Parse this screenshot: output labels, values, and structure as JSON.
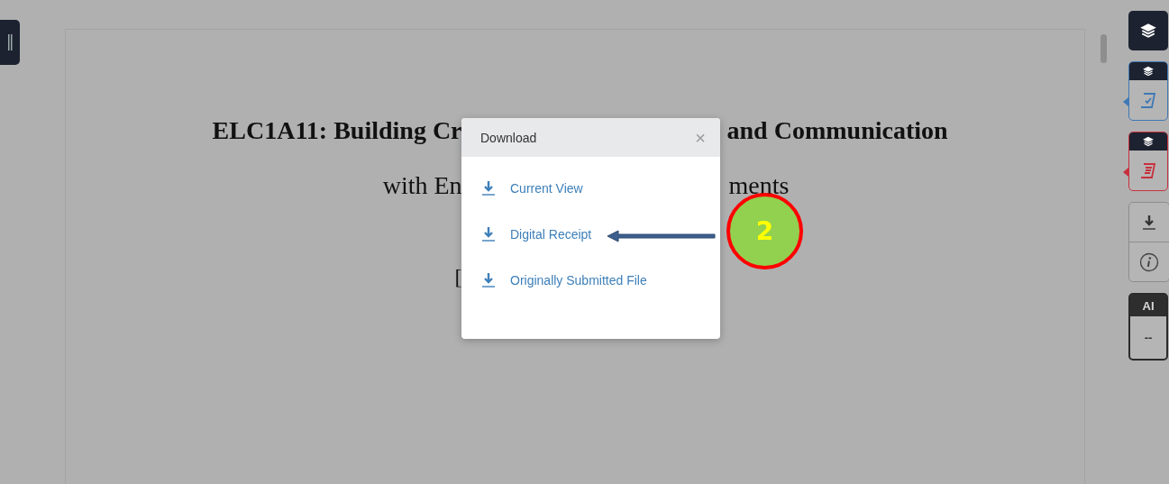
{
  "document": {
    "title_left": "ELC1A11: Building Cr",
    "title_right": "and Communication",
    "subtitle_left": "with En",
    "subtitle_right": "ments",
    "line_3_left": "["
  },
  "dialog": {
    "title": "Download",
    "close": "×",
    "items": [
      {
        "label": "Current View"
      },
      {
        "label": "Digital Receipt"
      },
      {
        "label": "Originally Submitted File"
      }
    ]
  },
  "annotation": {
    "number": "2"
  },
  "sidebar": {
    "cards": [
      {
        "kind": "match",
        "color": "#3f78b5"
      },
      {
        "kind": "report",
        "color": "#c8303c"
      }
    ],
    "ai_label": "AI",
    "ai_score": "--"
  }
}
